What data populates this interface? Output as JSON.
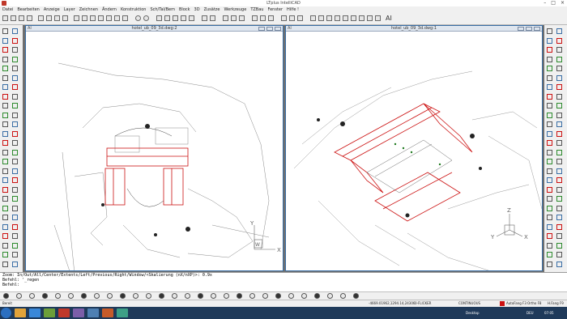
{
  "window": {
    "title": "LTplus IntelliCAD",
    "buttons": [
      "–",
      "□",
      "×"
    ]
  },
  "menu": [
    "Datei",
    "Bearbeiten",
    "Anzeige",
    "Layer",
    "Zeichnen",
    "Ändern",
    "Konstruktion",
    "Sch/Tal/Bem",
    "Block",
    "3D",
    "Zusätze",
    "Werkzeuge",
    "TZBau",
    "Fenster",
    "Hilfe !"
  ],
  "toolbar": {
    "ai_label": "AI"
  },
  "viewports": [
    {
      "title": "hotel_ub_09_3d.dwg:2",
      "corner": "AI",
      "ucs": {
        "x": "X",
        "y": "Y",
        "w": "W"
      }
    },
    {
      "title": "hotel_ub_09_3d.dwg:1",
      "corner": "AI",
      "ucs": {
        "x": "X",
        "y": "Y",
        "z": "Z"
      }
    }
  ],
  "command_lines": [
    "Zoom:  In/Out/All/Center/Extents/Left/Previous/Right/Window/<Skalierung (nX/nXP)>: 0.9x",
    "Befehl: '_regen",
    "Befehl:"
  ],
  "statusbar": {
    "left": "Bereit",
    "coords": "-4669.01962,1294.14,24306",
    "layer": "0-FLICKER",
    "linetype": "CONTINUOUS",
    "snap": "AutoFang F3",
    "ortho": "Ortho F8",
    "hfang": "H.Fang F9"
  },
  "taskbar": {
    "desktop": "Desktop",
    "lang": "DEU",
    "time": "07:05"
  },
  "colors": {
    "drawing_red": "#cc1111",
    "accent_blue": "#3a6ea5",
    "taskbar": "#1f3a5a"
  }
}
